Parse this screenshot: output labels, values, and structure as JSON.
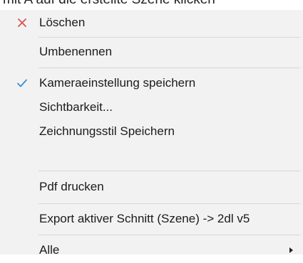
{
  "background_text": "mit A auf die erstellte Szene klicken",
  "menu": {
    "items": [
      {
        "label": "Löschen",
        "icon": "delete-x-icon",
        "icon_color": "#d9534f"
      },
      {
        "label": "Umbenennen"
      },
      {
        "label": "Kameraeinstellung speichern",
        "icon": "checkmark-icon",
        "icon_color": "#3a8fd0"
      },
      {
        "label": "Sichtbarkeit..."
      },
      {
        "label": "Zeichnungsstil Speichern"
      },
      {
        "label": "Pdf drucken"
      },
      {
        "label": "Export aktiver Schnitt (Szene) -> 2dl v5"
      },
      {
        "label": "Alle",
        "has_submenu": true
      }
    ]
  }
}
